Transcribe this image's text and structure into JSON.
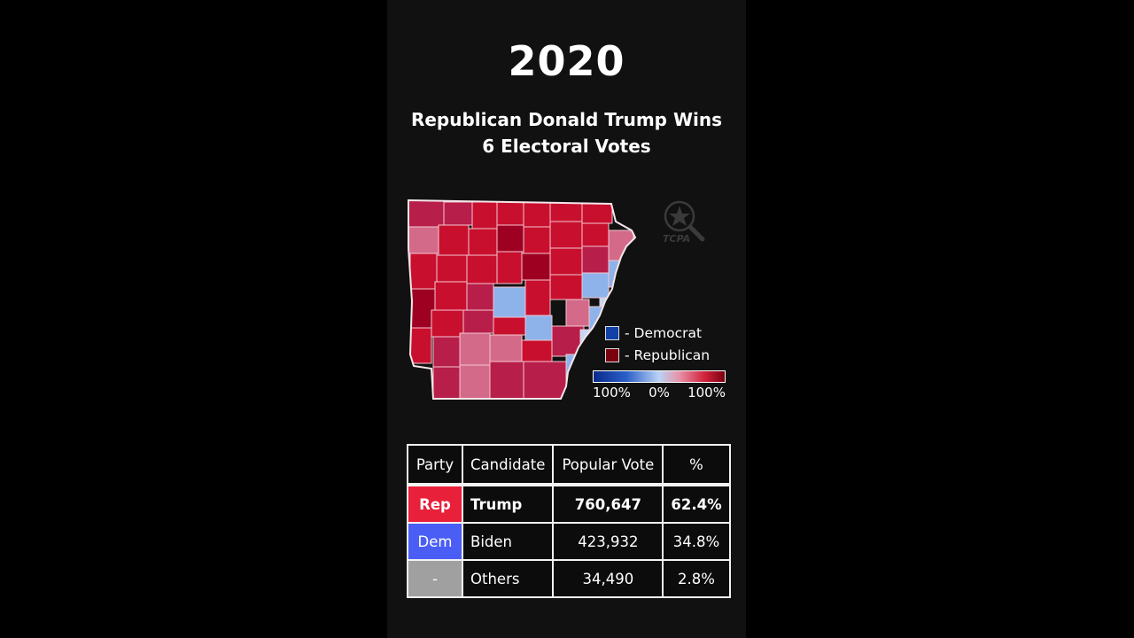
{
  "title": {
    "year": "2020",
    "headline_line1": "Republican Donald Trump Wins",
    "headline_line2": "6 Electoral Votes"
  },
  "logo": {
    "icon": "magnifier-star-icon",
    "text": "TCPA"
  },
  "map": {
    "state": "Arkansas",
    "description": "County-level results choropleth: red = Republican margin, blue = Democratic margin"
  },
  "legend": {
    "items": [
      {
        "label": "- Democrat",
        "color": "#1040a8"
      },
      {
        "label": "- Republican",
        "color": "#7a0010"
      }
    ],
    "scale_labels": [
      "100%",
      "0%",
      "100%"
    ]
  },
  "colors": {
    "rep_strong": "#9e0022",
    "rep": "#c8102e",
    "rep_mid": "#b81e4a",
    "rep_light": "#d36a8a",
    "dem_light": "#c3d7f5",
    "dem": "#8eb3ea",
    "party_rep": "#e8203a",
    "party_dem": "#4a5ef5",
    "party_other": "#a0a0a0"
  },
  "table": {
    "headers": [
      "Party",
      "Candidate",
      "Popular Vote",
      "%"
    ],
    "rows": [
      {
        "party": "Rep",
        "candidate": "Trump",
        "votes": "760,647",
        "pct": "62.4%",
        "bold": true
      },
      {
        "party": "Dem",
        "candidate": "Biden",
        "votes": "423,932",
        "pct": "34.8%",
        "bold": false
      },
      {
        "party": "-",
        "candidate": "Others",
        "votes": "34,490",
        "pct": "2.8%",
        "bold": false
      }
    ]
  }
}
